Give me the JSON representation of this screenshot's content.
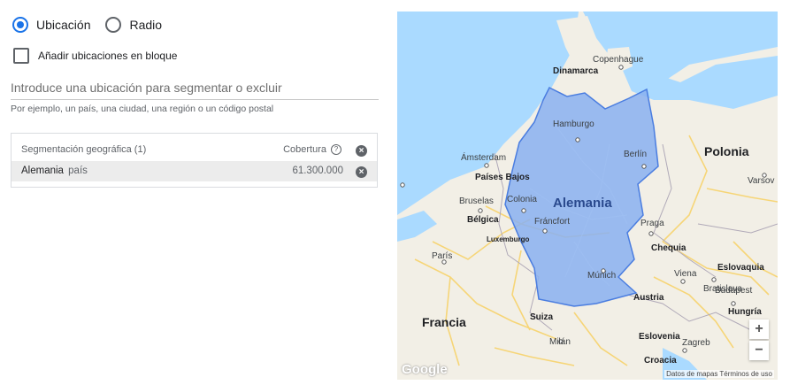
{
  "targeting_mode": {
    "options": [
      {
        "label": "Ubicación",
        "selected": true
      },
      {
        "label": "Radio",
        "selected": false
      }
    ]
  },
  "bulk_checkbox": {
    "label": "Añadir ubicaciones en bloque",
    "checked": false
  },
  "search": {
    "placeholder": "Introduce una ubicación para segmentar o excluir",
    "value": "",
    "hint": "Por ejemplo, un país, una ciudad, una región o un código postal"
  },
  "table": {
    "header_left": "Segmentación geográfica (1)",
    "header_right": "Cobertura",
    "rows": [
      {
        "name": "Alemania",
        "type": "país",
        "coverage": "61.300.000"
      }
    ]
  },
  "map": {
    "selected_region": "Alemania",
    "countries": [
      "Polonia",
      "Francia",
      "Bélgica",
      "Países Bajos",
      "Chequia",
      "Eslovaquia",
      "Austria",
      "Hungría",
      "Suiza",
      "Eslovenia",
      "Croacia",
      "Dinamarca",
      "Luxemburgo"
    ],
    "cities": [
      "Copenhague",
      "Hamburgo",
      "Berlín",
      "Ámsterdam",
      "Bruselas",
      "Colonia",
      "Fráncfort",
      "Praga",
      "París",
      "Múnich",
      "Viena",
      "Bratislava",
      "Budapest",
      "Milán",
      "Zagreb",
      "Varsov"
    ],
    "zoom_in": "+",
    "zoom_out": "−",
    "logo": "Google",
    "attribution": "Datos de mapas   Términos de uso",
    "colors": {
      "water": "#aadaff",
      "land": "#f2efe6",
      "region_fill": "#8ab0f0",
      "region_stroke": "#4a7de0",
      "road": "#f7d36b"
    }
  }
}
